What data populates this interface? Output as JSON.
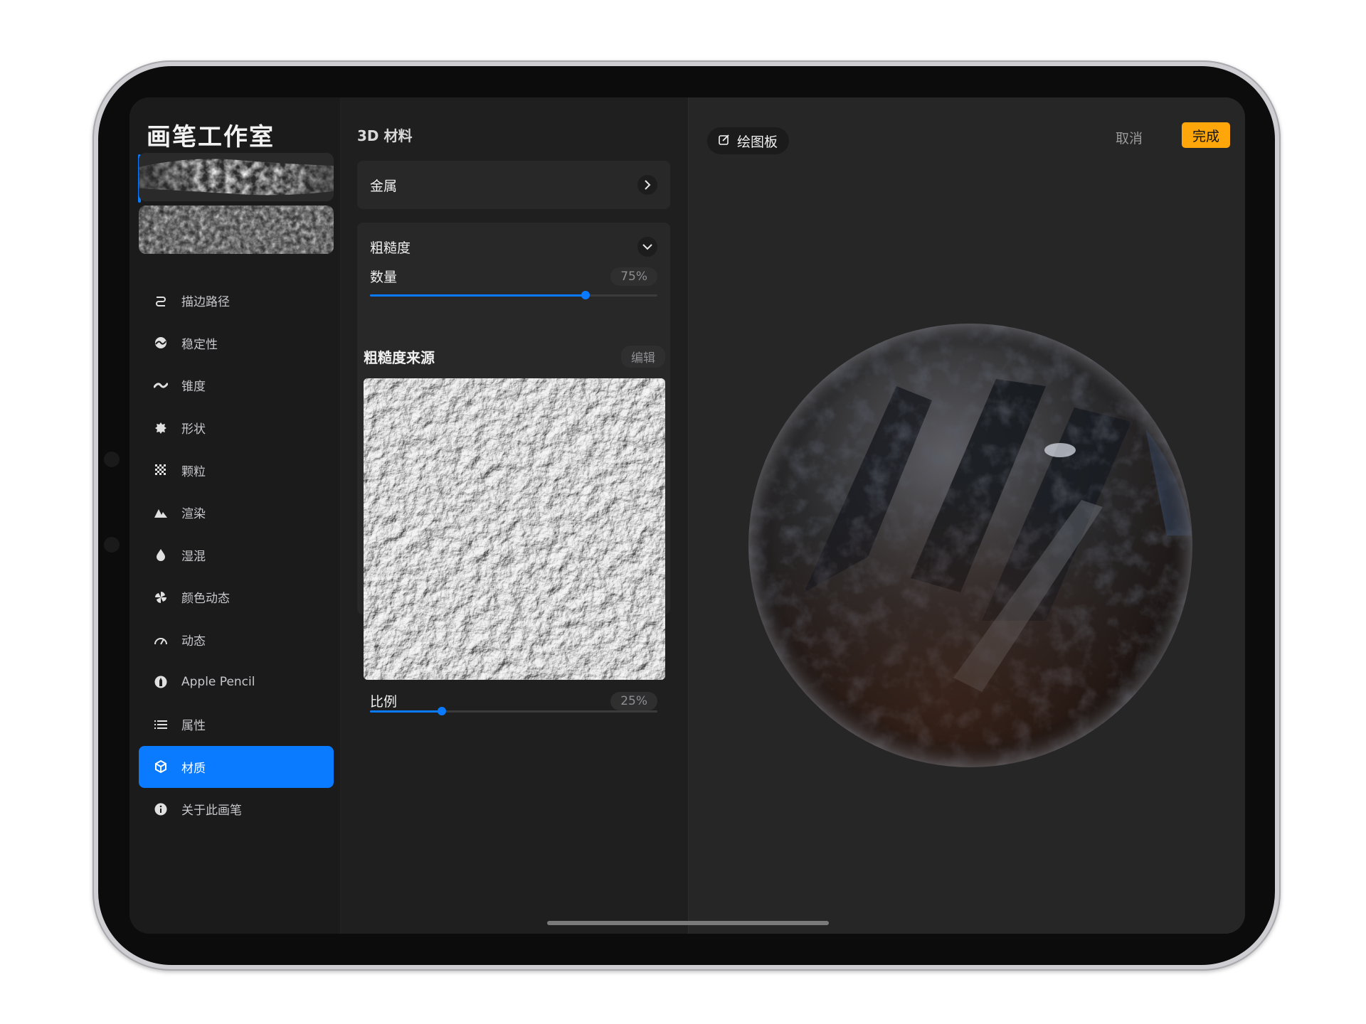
{
  "header": {
    "title": "画笔工作室"
  },
  "sidebar": {
    "items": [
      {
        "label": "描边路径",
        "icon": "stroke-path-icon"
      },
      {
        "label": "稳定性",
        "icon": "stabilization-icon"
      },
      {
        "label": "锥度",
        "icon": "taper-icon"
      },
      {
        "label": "形状",
        "icon": "shape-icon"
      },
      {
        "label": "颗粒",
        "icon": "grain-icon"
      },
      {
        "label": "渲染",
        "icon": "rendering-icon"
      },
      {
        "label": "湿混",
        "icon": "wet-mix-icon"
      },
      {
        "label": "颜色动态",
        "icon": "color-dynamics-icon"
      },
      {
        "label": "动态",
        "icon": "dynamics-icon"
      },
      {
        "label": "Apple Pencil",
        "icon": "apple-pencil-icon"
      },
      {
        "label": "属性",
        "icon": "properties-icon"
      },
      {
        "label": "材质",
        "icon": "materials-icon",
        "active": true
      },
      {
        "label": "关于此画笔",
        "icon": "info-icon"
      }
    ]
  },
  "middle": {
    "title": "3D 材料",
    "metal": {
      "label": "金属"
    },
    "roughness": {
      "label": "粗糙度",
      "amount_label": "数量",
      "amount_value": "75%",
      "amount_fraction": 0.75,
      "source_label": "粗糙度来源",
      "edit_label": "编辑",
      "scale_label": "比例",
      "scale_value": "25%",
      "scale_fraction": 0.25
    }
  },
  "preview": {
    "canvas_label": "绘图板",
    "cancel_label": "取消",
    "done_label": "完成"
  },
  "colors": {
    "accent": "#0a7aff",
    "done": "#ffa70a"
  }
}
